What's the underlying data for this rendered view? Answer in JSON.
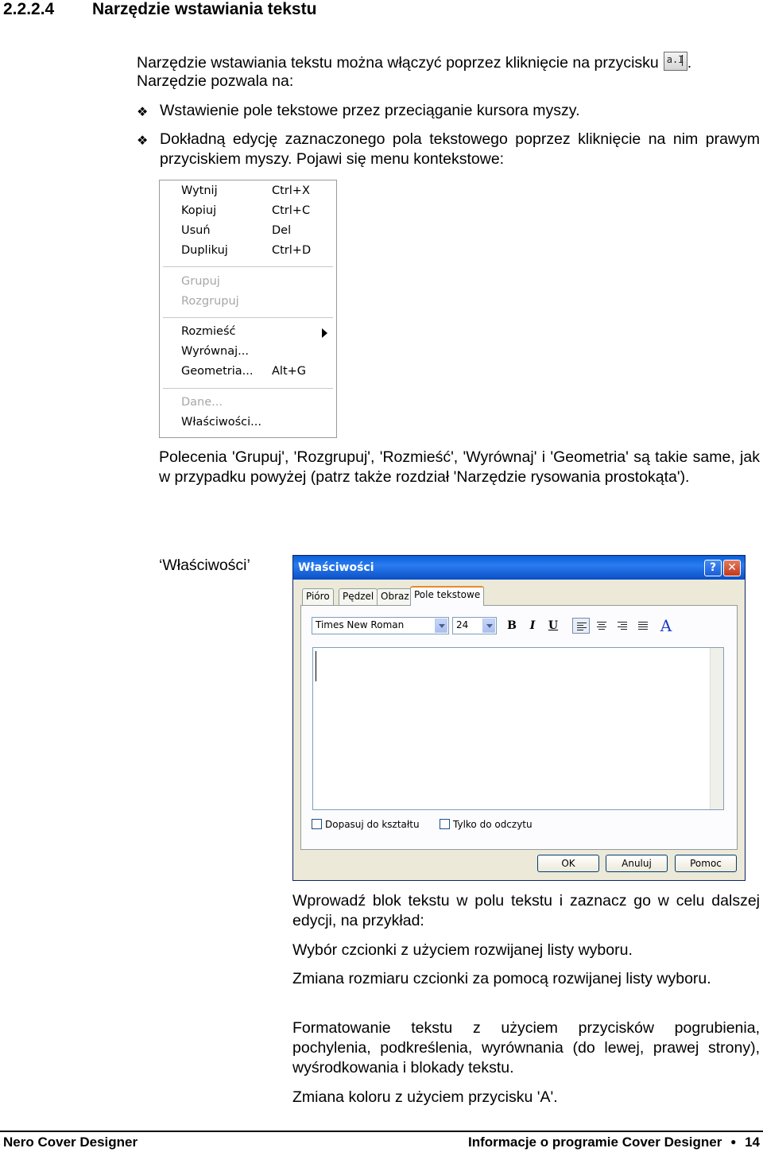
{
  "heading": {
    "number": "2.2.2.4",
    "title": "Narzędzie wstawiania tekstu"
  },
  "intro": {
    "line1": "Narzędzie wstawiania tekstu można włączyć poprzez kliknięcie na przycisku",
    "line1_end": ".",
    "line2": "Narzędzie pozwala na:",
    "icon_text": "a.I",
    "icon_name": "text-tool-icon"
  },
  "bullets": {
    "glyph": "❖",
    "item1": "Wstawienie pole tekstowe przez przeciąganie kursora myszy.",
    "item2": "Dokładną edycję zaznaczonego pola tekstowego poprzez kliknięcie na nim prawym przyciskiem myszy. Pojawi się menu kontekstowe:"
  },
  "context_menu": {
    "groups": [
      [
        {
          "label": "Wytnij",
          "shortcut": "Ctrl+X"
        },
        {
          "label": "Kopiuj",
          "shortcut": "Ctrl+C"
        },
        {
          "label": "Usuń",
          "shortcut": "Del"
        },
        {
          "label": "Duplikuj",
          "shortcut": "Ctrl+D"
        }
      ],
      [
        {
          "label": "Grupuj",
          "shortcut": "",
          "disabled": true
        },
        {
          "label": "Rozgrupuj",
          "shortcut": "",
          "disabled": true
        }
      ],
      [
        {
          "label": "Rozmieść",
          "shortcut": "",
          "submenu": true
        },
        {
          "label": "Wyrównaj...",
          "shortcut": ""
        },
        {
          "label": "Geometria...",
          "shortcut": "Alt+G"
        }
      ],
      [
        {
          "label": "Dane...",
          "shortcut": "",
          "disabled": true
        },
        {
          "label": "Właściwości...",
          "shortcut": ""
        }
      ]
    ]
  },
  "para_commands": "Polecenia 'Grupuj', 'Rozgrupuj', 'Rozmieść', 'Wyrównaj' i 'Geometria' są takie same, jak w przypadku powyżej (patrz także rozdział 'Narzędzie rysowania prostokąta').",
  "properties_label": "‘Właściwości’",
  "dialog": {
    "title": "Właściwości",
    "help": "?",
    "close": "✕",
    "tabs": [
      "Pióro",
      "Pędzel",
      "Obraz",
      "Pole tekstowe"
    ],
    "active_tab": "Pole tekstowe",
    "font_value": "Times New Roman",
    "size_value": "24",
    "bold": "B",
    "italic": "I",
    "underline": "U",
    "color_button": "A",
    "checkbox_fit": "Dopasuj do kształtu",
    "checkbox_readonly": "Tylko do odczytu",
    "ok": "OK",
    "cancel": "Anuluj",
    "help_button": "Pomoc"
  },
  "right_paras": {
    "p1": "Wprowadź blok tekstu w polu tekstu i zaznacz go w celu dalszej edycji, na przykład:",
    "p2": "Wybór czcionki z użyciem rozwijanej listy wyboru.",
    "p3": "Zmiana rozmiaru czcionki za pomocą rozwijanej listy wyboru.",
    "p4": "Formatowanie tekstu z użyciem przycisków pogrubienia, pochylenia, podkreślenia, wyrównania (do lewej, prawej strony), wyśrodkowania i blokady tekstu.",
    "p5": "Zmiana koloru z użyciem przycisku 'A'."
  },
  "footer": {
    "left": "Nero Cover Designer",
    "right": "Informacje o programie Cover Designer",
    "bullet": "●",
    "page": "14"
  }
}
